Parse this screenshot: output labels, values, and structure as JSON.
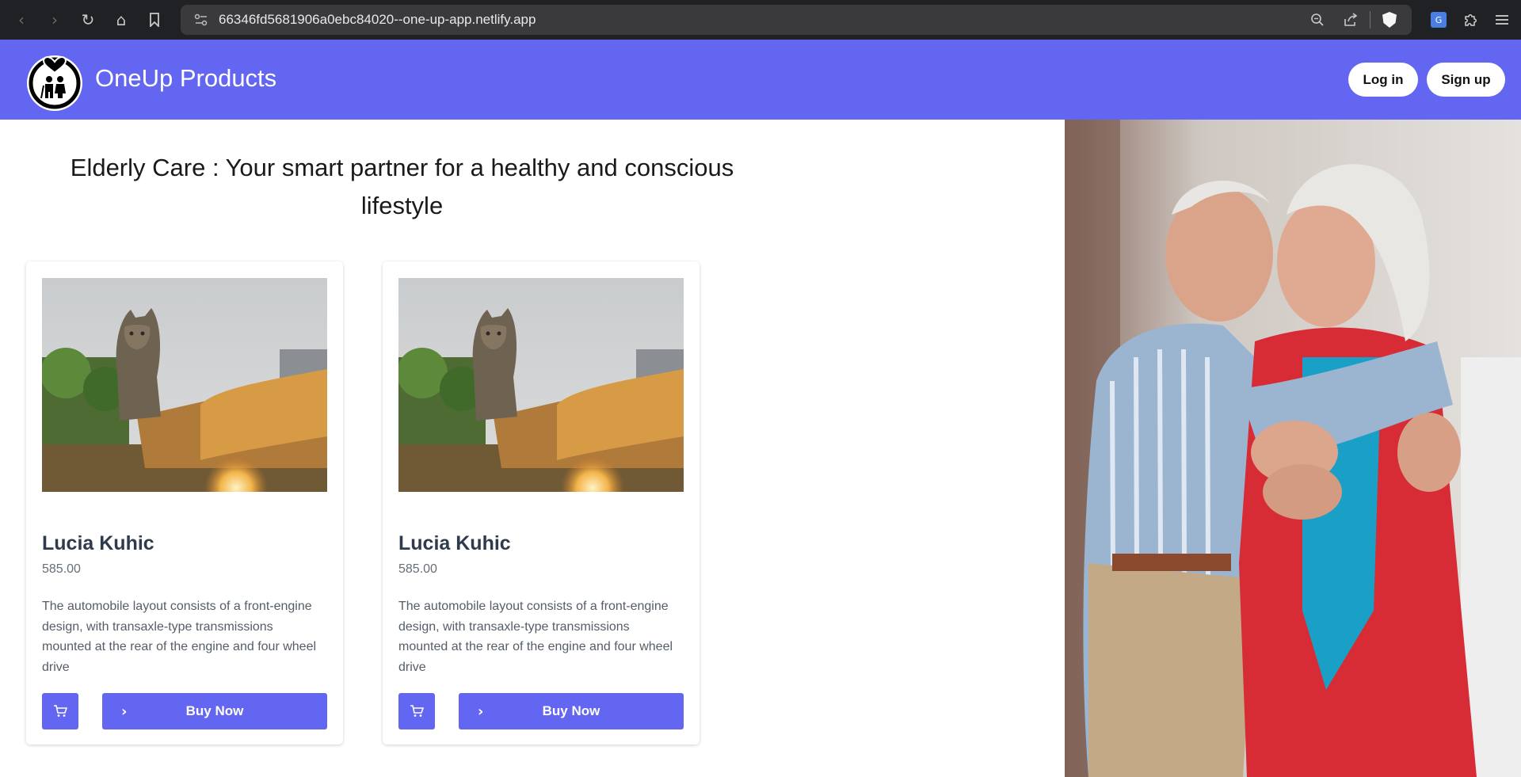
{
  "browser": {
    "url": "66346fd5681906a0ebc84020--one-up-app.netlify.app",
    "icons": [
      "back-icon",
      "forward-icon",
      "reload-icon",
      "home-icon",
      "bookmark-icon",
      "site-info-icon",
      "zoom-icon",
      "share-icon",
      "brave-shield-icon",
      "translate-icon",
      "extensions-icon",
      "menu-icon"
    ]
  },
  "header": {
    "brand": "OneUp Products",
    "login_label": "Log in",
    "signup_label": "Sign up"
  },
  "main": {
    "title": "Elderly Care : Your smart partner for a healthy and conscious lifestyle",
    "products": [
      {
        "name": "Lucia Kuhic",
        "price": "585.00",
        "description": "The automobile layout consists of a front-engine design, with transaxle-type transmissions mounted at the rear of the engine and four wheel drive",
        "buy_label": "Buy Now"
      },
      {
        "name": "Lucia Kuhic",
        "price": "585.00",
        "description": "The automobile layout consists of a front-engine design, with transaxle-type transmissions mounted at the rear of the engine and four wheel drive",
        "buy_label": "Buy Now"
      }
    ]
  },
  "colors": {
    "accent": "#6366f1",
    "browser_chrome": "#202124",
    "url_bar": "#3a3a3d"
  }
}
